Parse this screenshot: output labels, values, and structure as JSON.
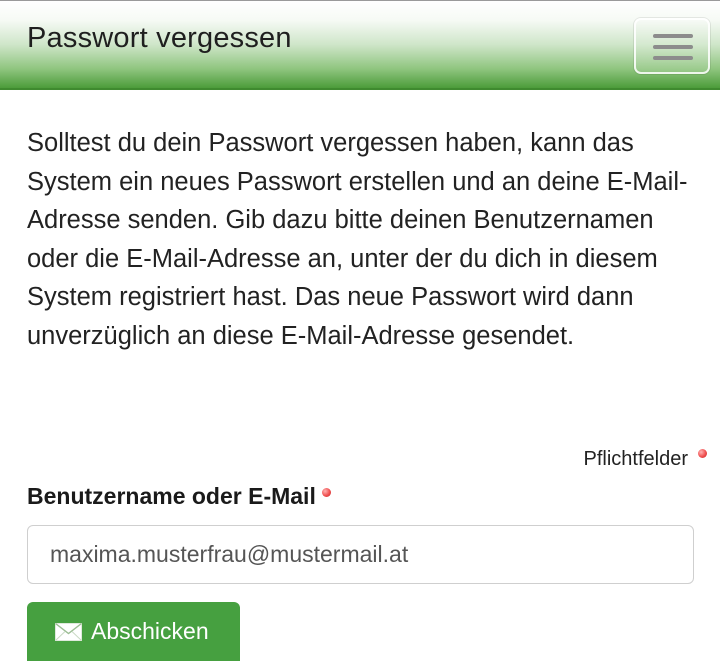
{
  "header": {
    "title": "Passwort vergessen",
    "menu_icon": "hamburger-menu-icon"
  },
  "content": {
    "intro_text": "Solltest du dein Passwort vergessen haben, kann das System ein neues Passwort erstellen und an deine E-Mail-Adresse senden. Gib dazu bitte deinen Benutzernamen oder die E-Mail-Adresse an, unter der du dich in diesem System registriert hast. Das neue Passwort wird dann unverzüglich an diese E-Mail-Adresse gesendet."
  },
  "form": {
    "required_note": "Pflichtfelder",
    "username_label": "Benutzername oder E-Mail",
    "username_value": "maxima.musterfrau@mustermail.at",
    "submit_label": "Abschicken",
    "submit_icon": "envelope-icon"
  },
  "colors": {
    "accent_green": "#46a040",
    "required_marker": "#f05050"
  }
}
